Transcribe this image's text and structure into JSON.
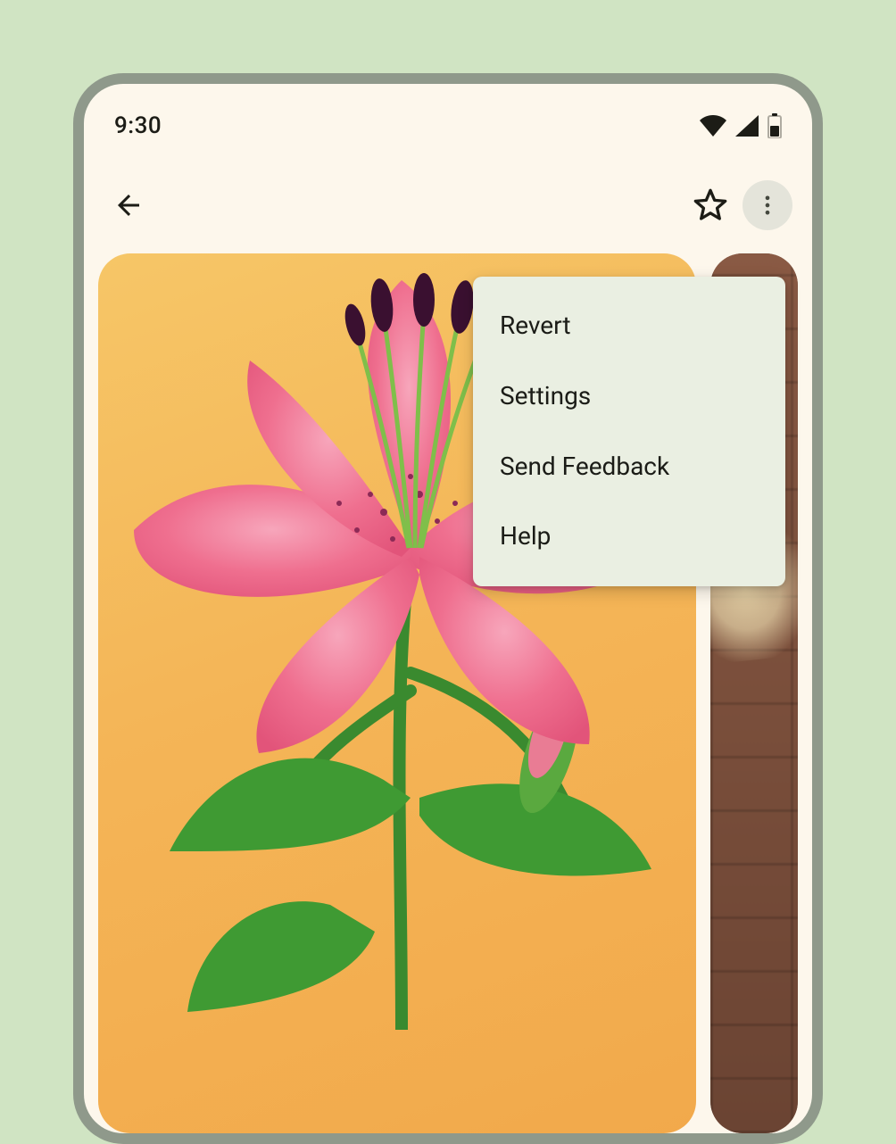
{
  "status": {
    "time": "9:30"
  },
  "menu": {
    "items": [
      {
        "label": "Revert"
      },
      {
        "label": "Settings"
      },
      {
        "label": "Send Feedback"
      },
      {
        "label": "Help"
      }
    ]
  }
}
